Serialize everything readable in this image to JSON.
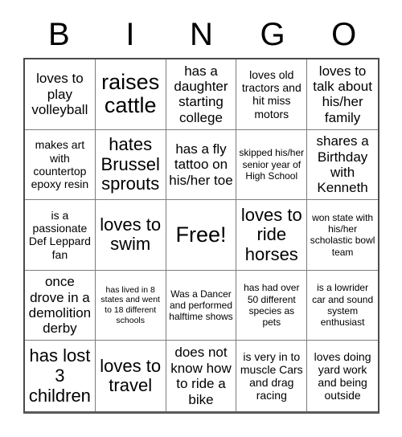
{
  "header": {
    "letters": [
      "B",
      "I",
      "N",
      "G",
      "O"
    ]
  },
  "grid": {
    "rows": 5,
    "columns": 5,
    "free_space_index": 12,
    "cells": [
      {
        "text": "loves to play volleyball",
        "size": "fs-md"
      },
      {
        "text": "raises cattle",
        "size": "fs-xl"
      },
      {
        "text": "has a daughter starting college",
        "size": "fs-md"
      },
      {
        "text": "loves old tractors and hit miss motors",
        "size": "fs-sm"
      },
      {
        "text": "loves to talk about his/her family",
        "size": "fs-md"
      },
      {
        "text": "makes art with countertop epoxy resin",
        "size": "fs-sm"
      },
      {
        "text": "hates Brussel sprouts",
        "size": "fs-lg"
      },
      {
        "text": "has a fly tattoo on his/her toe",
        "size": "fs-md"
      },
      {
        "text": "skipped his/her senior year of High School",
        "size": "fs-xs"
      },
      {
        "text": "shares a Birthday with Kenneth",
        "size": "fs-md"
      },
      {
        "text": "is a passionate Def Leppard fan",
        "size": "fs-sm"
      },
      {
        "text": "loves to swim",
        "size": "fs-lg"
      },
      {
        "text": "Free!",
        "size": "fs-xl"
      },
      {
        "text": "loves to ride horses",
        "size": "fs-lg"
      },
      {
        "text": "won state with his/her scholastic bowl team",
        "size": "fs-xs"
      },
      {
        "text": "once drove in a demolition derby",
        "size": "fs-md"
      },
      {
        "text": "has lived in 8 states and went to 18 different schools",
        "size": "fs-xxs"
      },
      {
        "text": "Was a Dancer and performed halftime shows",
        "size": "fs-xs"
      },
      {
        "text": "has had over 50 different species as pets",
        "size": "fs-xs"
      },
      {
        "text": "is a lowrider car and sound system enthusiast",
        "size": "fs-xs"
      },
      {
        "text": "has lost 3 children",
        "size": "fs-lg"
      },
      {
        "text": "loves to travel",
        "size": "fs-lg"
      },
      {
        "text": "does not know how to ride a bike",
        "size": "fs-md"
      },
      {
        "text": "is very in to muscle Cars and drag racing",
        "size": "fs-sm"
      },
      {
        "text": "loves doing yard work and being outside",
        "size": "fs-sm"
      }
    ]
  },
  "colors": {
    "background": "#ffffff",
    "text": "#000000",
    "grid_line": "#7d7d7d",
    "grid_border": "#4a4a4a"
  }
}
